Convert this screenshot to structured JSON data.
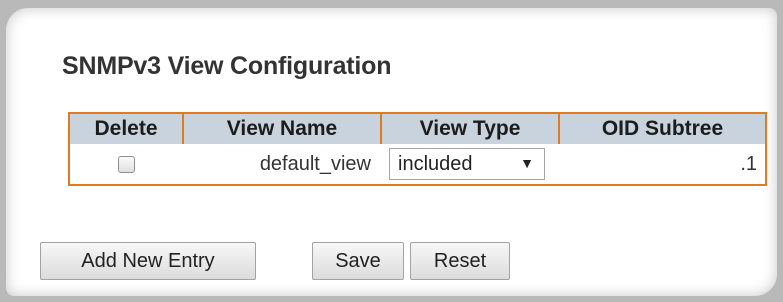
{
  "page": {
    "title": "SNMPv3 View Configuration"
  },
  "table": {
    "headers": {
      "delete": "Delete",
      "view_name": "View Name",
      "view_type": "View Type",
      "oid_subtree": "OID Subtree"
    },
    "rows": [
      {
        "delete_checked": false,
        "view_name": "default_view",
        "view_type": "included",
        "oid_subtree": ".1"
      }
    ]
  },
  "buttons": {
    "add_new_entry": "Add New Entry",
    "save": "Save",
    "reset": "Reset"
  },
  "colors": {
    "table_border": "#e07b22",
    "header_background": "#c9d3de"
  },
  "icons": {
    "select_arrow": "▼"
  }
}
